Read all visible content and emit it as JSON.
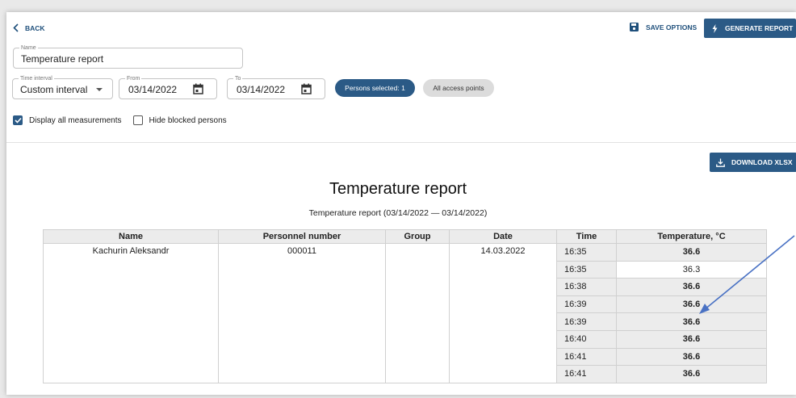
{
  "header": {
    "back_label": "BACK",
    "save_options_label": "SAVE OPTIONS",
    "generate_label": "GENERATE REPORT"
  },
  "form": {
    "name": {
      "label": "Name",
      "value": "Temperature report"
    },
    "interval": {
      "label": "Time interval",
      "value": "Custom interval"
    },
    "from": {
      "label": "From",
      "value": "03/14/2022"
    },
    "to": {
      "label": "To",
      "value": "03/14/2022"
    },
    "persons_chip": "Persons selected: 1",
    "access_chip": "All access points",
    "display_all_label": "Display all measurements",
    "hide_blocked_label": "Hide blocked persons"
  },
  "report": {
    "download_label": "DOWNLOAD XLSX",
    "title": "Temperature report",
    "subtitle": "Temperature report (03/14/2022 — 03/14/2022)",
    "columns": [
      "Name",
      "Personnel number",
      "Group",
      "Date",
      "Time",
      "Temperature, °C"
    ],
    "person": {
      "name": "Kachurin Aleksandr",
      "number": "000011",
      "group": "",
      "date": "14.03.2022"
    },
    "rows": [
      {
        "time": "16:35",
        "temp": "36.6"
      },
      {
        "time": "16:35",
        "temp": "36.3"
      },
      {
        "time": "16:38",
        "temp": "36.6"
      },
      {
        "time": "16:39",
        "temp": "36.6"
      },
      {
        "time": "16:39",
        "temp": "36.6"
      },
      {
        "time": "16:40",
        "temp": "36.6"
      },
      {
        "time": "16:41",
        "temp": "36.6"
      },
      {
        "time": "16:41",
        "temp": "36.6"
      }
    ]
  },
  "colors": {
    "accent": "#2b5a86",
    "arrow": "#4a72c4"
  }
}
